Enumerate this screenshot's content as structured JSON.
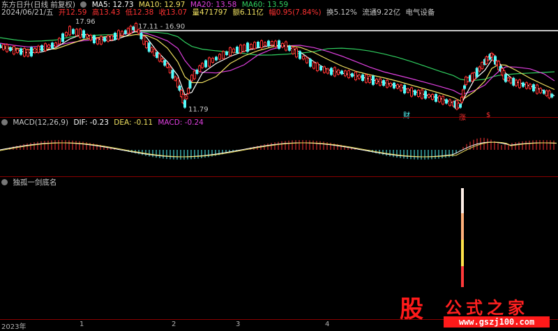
{
  "header": {
    "title": "东方日升(日线 前复权)",
    "ma5": "MA5: 12.73",
    "ma10": "MA10: 12.97",
    "ma20": "MA20: 13.58",
    "ma60": "MA60: 13.59",
    "date": "2024/06/21/五",
    "open": "开12.59",
    "high": "高13.43",
    "low": "低12.38",
    "close": "收13.07",
    "volume": "量471797",
    "amount": "额6.11亿",
    "change": "幅0.95(7.84%)",
    "turnover": "换5.12%",
    "float_cap": "流通9.22亿",
    "sector": "电气设备"
  },
  "price_chart": {
    "annotations": {
      "high": "17.96",
      "range": "17.11 - 16.90",
      "low": "11.79"
    },
    "markers": [
      "财",
      "涨",
      "$"
    ]
  },
  "macd": {
    "title": "MACD(12,26,9)",
    "dif": "DIF: -0.23",
    "dea": "DEA: -0.11",
    "macd": "MACD: -0.24"
  },
  "indicator": {
    "title": "独孤一剑底名"
  },
  "x_axis": [
    "2023年",
    "1",
    "2",
    "3",
    "4"
  ],
  "watermark": {
    "logo": "股",
    "title": "公式之家",
    "url": "www.gszj100.com"
  },
  "colors": {
    "ma5": "#ffffff",
    "ma10": "#f0e060",
    "ma20": "#e040e0",
    "ma60": "#30d060",
    "up": "#ff3232",
    "down": "#54fcfc",
    "separator": "#8a0000"
  }
}
